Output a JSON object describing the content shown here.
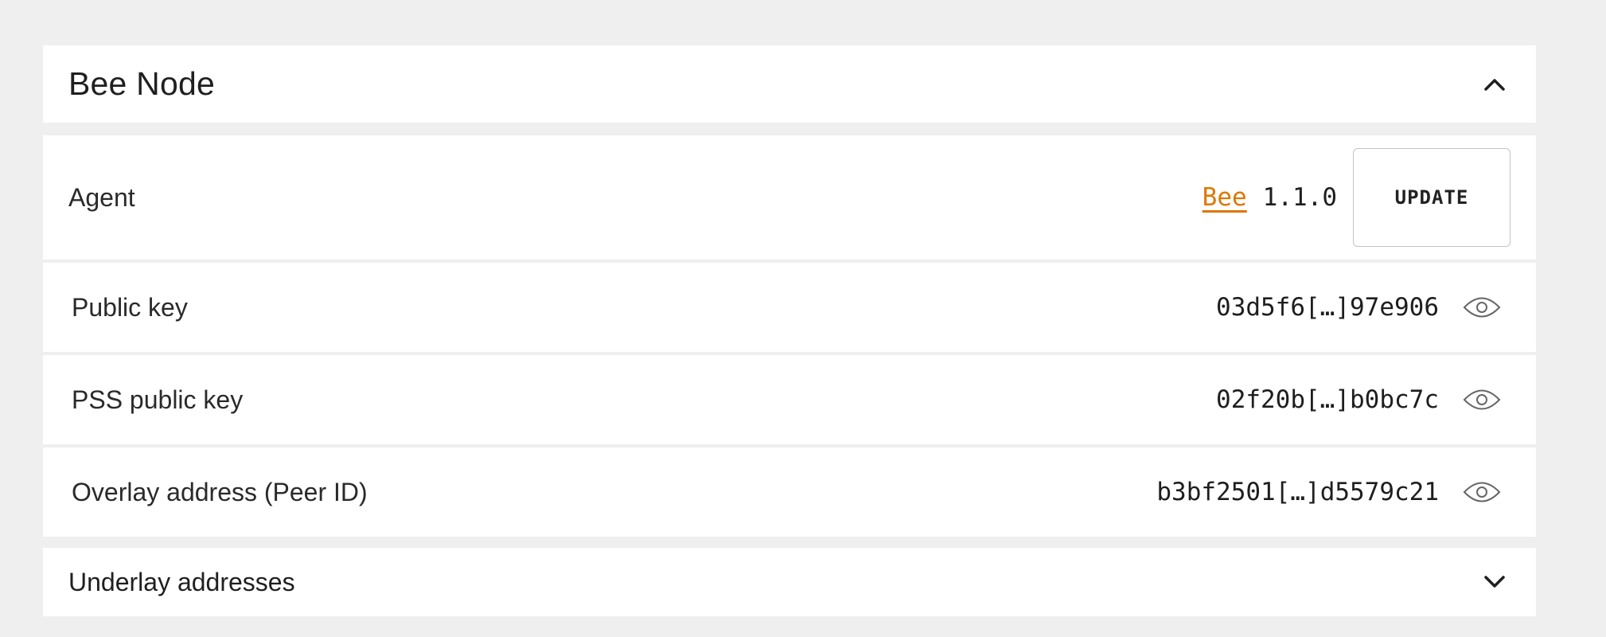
{
  "section": {
    "title": "Bee Node",
    "collapse_icon": "chevron-up-icon"
  },
  "agent": {
    "label": "Agent",
    "link_text": "Bee",
    "link_color": "#dd7700",
    "version": "1.1.0",
    "update_label": "UPDATE"
  },
  "keys": [
    {
      "label": "Public key",
      "value": "03d5f6[…]97e906",
      "icon": "eye-icon"
    },
    {
      "label": "PSS public key",
      "value": "02f20b[…]b0bc7c",
      "icon": "eye-icon"
    },
    {
      "label": "Overlay address (Peer ID)",
      "value": "b3bf2501[…]d5579c21",
      "icon": "eye-icon"
    }
  ],
  "underlay": {
    "title": "Underlay addresses",
    "expand_icon": "chevron-down-icon"
  }
}
